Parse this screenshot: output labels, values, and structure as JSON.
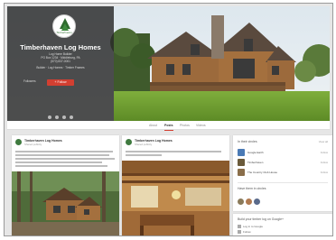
{
  "profile": {
    "name": "Timberhaven Log Homes",
    "logo_text": "Timberhaven",
    "address_lines": [
      "Log Home Builder",
      "PO Box 1234 · Middleburg, PA",
      "(570) 837-0001"
    ],
    "tagline": "Builder · Log Homes · Timber Frames",
    "followers_text": "Followers",
    "follow_label": "+ Follow"
  },
  "tabs": [
    "About",
    "Posts",
    "Photos",
    "Videos"
  ],
  "active_tab": "Posts",
  "posts": [
    {
      "author": "Timberhaven Log Homes",
      "meta": "Shared publicly"
    },
    {
      "author": "Timberhaven Log Homes",
      "meta": "Shared publicly"
    }
  ],
  "circles": {
    "title": "In their circles",
    "link": "View all",
    "people": [
      {
        "name": "Google Earth",
        "action": "Follow",
        "color": "#4a7ab5"
      },
      {
        "name": "Timberhaven",
        "action": "Follow",
        "color": "#6a5a3a"
      },
      {
        "name": "The Country Club House",
        "action": "Follow",
        "color": "#8a6e4a"
      }
    ],
    "have_title": "Have them in circles",
    "have_colors": [
      "#8a7a5a",
      "#b07a50",
      "#5a6a8a"
    ]
  },
  "build": {
    "title": "Build your timber log on Google+",
    "links": [
      "Log in to Google",
      "Follow"
    ]
  },
  "colors": {
    "accent": "#d23f31",
    "profile_panel": "#2a2a2a",
    "background": "#e6e6e6"
  }
}
